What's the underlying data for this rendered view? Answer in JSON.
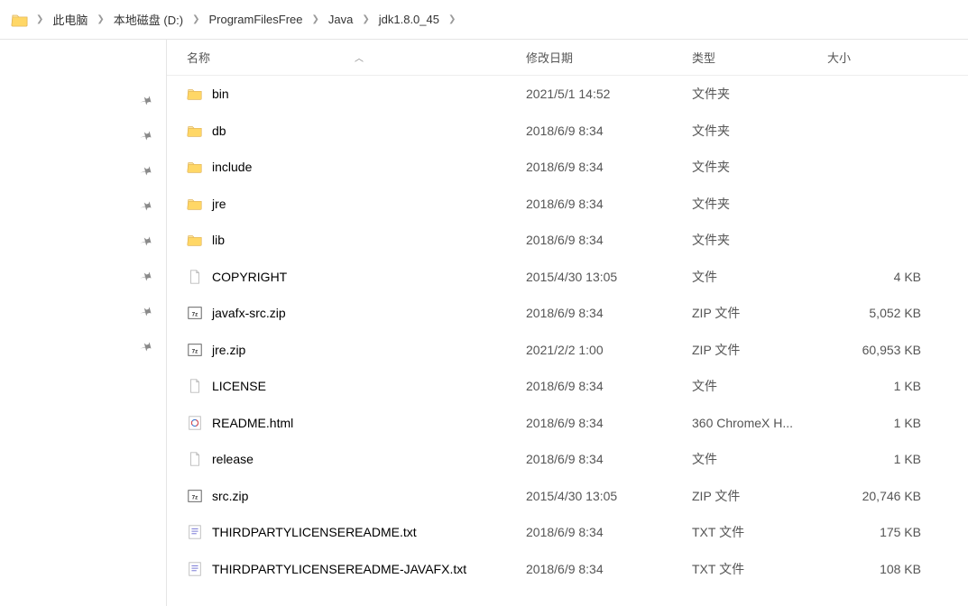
{
  "breadcrumb": {
    "items": [
      {
        "label": "此电脑"
      },
      {
        "label": "本地磁盘 (D:)"
      },
      {
        "label": "ProgramFilesFree"
      },
      {
        "label": "Java"
      },
      {
        "label": "jdk1.8.0_45"
      }
    ]
  },
  "columns": {
    "name": "名称",
    "date": "修改日期",
    "type": "类型",
    "size": "大小",
    "sort_indicator": "︿"
  },
  "files": [
    {
      "icon": "folder",
      "name": "bin",
      "date": "2021/5/1 14:52",
      "type": "文件夹",
      "size": ""
    },
    {
      "icon": "folder",
      "name": "db",
      "date": "2018/6/9 8:34",
      "type": "文件夹",
      "size": ""
    },
    {
      "icon": "folder",
      "name": "include",
      "date": "2018/6/9 8:34",
      "type": "文件夹",
      "size": ""
    },
    {
      "icon": "folder",
      "name": "jre",
      "date": "2018/6/9 8:34",
      "type": "文件夹",
      "size": ""
    },
    {
      "icon": "folder",
      "name": "lib",
      "date": "2018/6/9 8:34",
      "type": "文件夹",
      "size": ""
    },
    {
      "icon": "file",
      "name": "COPYRIGHT",
      "date": "2015/4/30 13:05",
      "type": "文件",
      "size": "4 KB"
    },
    {
      "icon": "zip",
      "name": "javafx-src.zip",
      "date": "2018/6/9 8:34",
      "type": "ZIP 文件",
      "size": "5,052 KB"
    },
    {
      "icon": "zip",
      "name": "jre.zip",
      "date": "2021/2/2 1:00",
      "type": "ZIP 文件",
      "size": "60,953 KB"
    },
    {
      "icon": "file",
      "name": "LICENSE",
      "date": "2018/6/9 8:34",
      "type": "文件",
      "size": "1 KB"
    },
    {
      "icon": "html",
      "name": "README.html",
      "date": "2018/6/9 8:34",
      "type": "360 ChromeX H...",
      "size": "1 KB"
    },
    {
      "icon": "file",
      "name": "release",
      "date": "2018/6/9 8:34",
      "type": "文件",
      "size": "1 KB"
    },
    {
      "icon": "zip",
      "name": "src.zip",
      "date": "2015/4/30 13:05",
      "type": "ZIP 文件",
      "size": "20,746 KB"
    },
    {
      "icon": "txt",
      "name": "THIRDPARTYLICENSEREADME.txt",
      "date": "2018/6/9 8:34",
      "type": "TXT 文件",
      "size": "175 KB"
    },
    {
      "icon": "txt",
      "name": "THIRDPARTYLICENSEREADME-JAVAFX.txt",
      "date": "2018/6/9 8:34",
      "type": "TXT 文件",
      "size": "108 KB"
    }
  ],
  "nav_pin_count": 8
}
